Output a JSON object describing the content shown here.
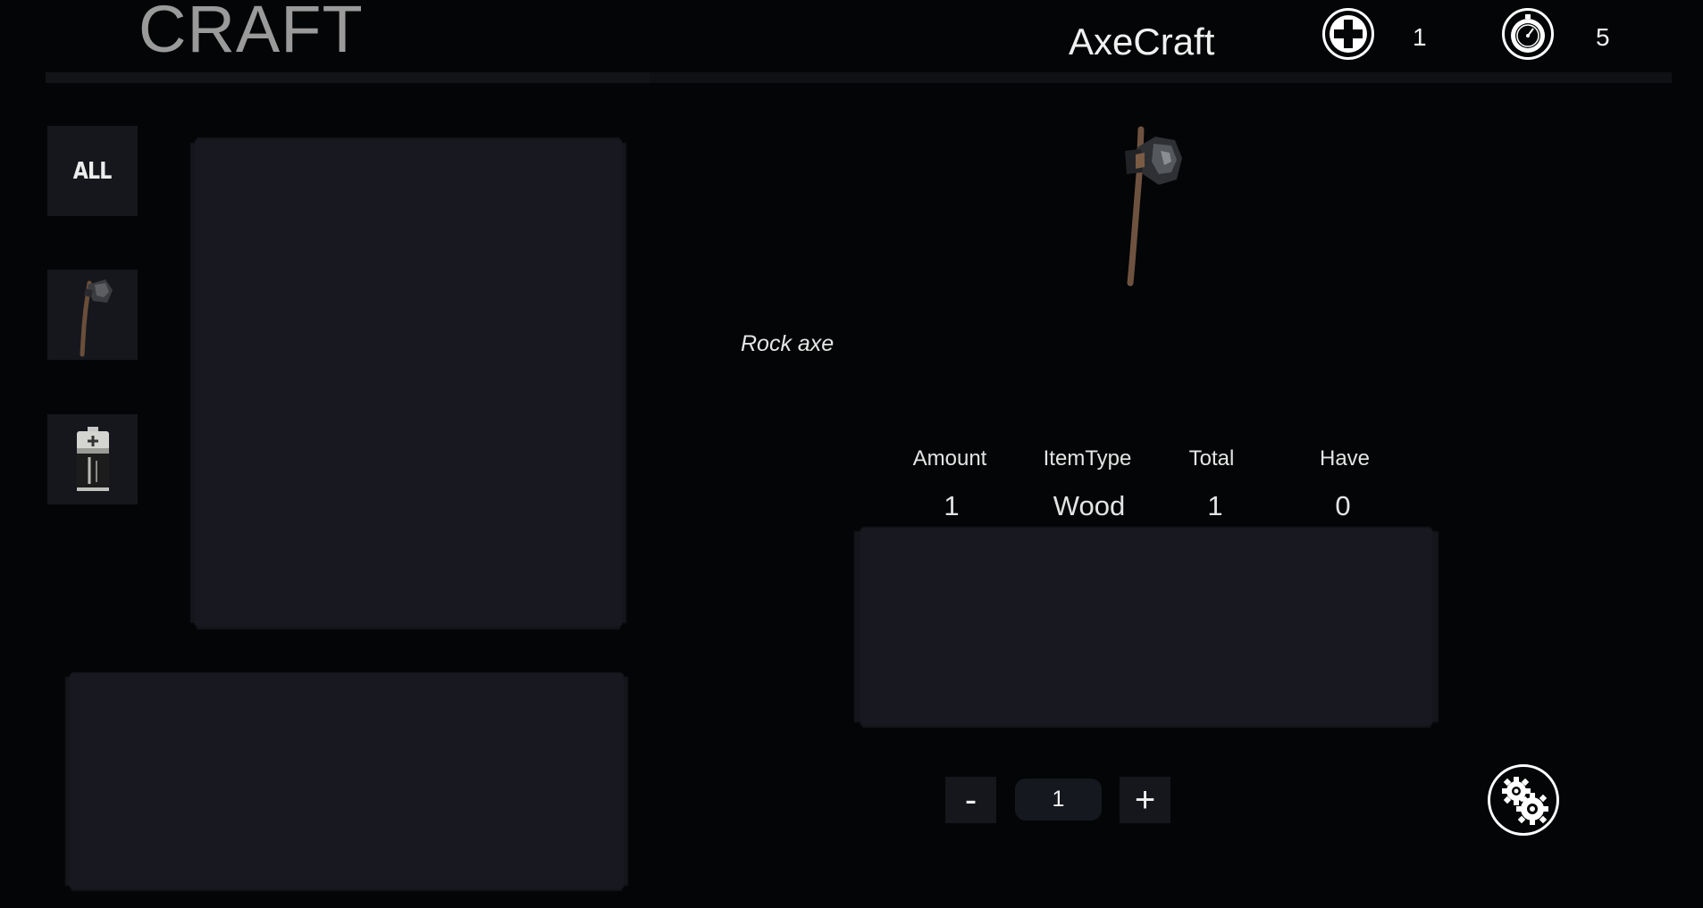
{
  "header": {
    "title": "CRAFT",
    "recipe_name": "AxeCraft",
    "health_icon": "plus-circle-icon",
    "health_value": "1",
    "timer_icon": "stopwatch-icon",
    "timer_value": "5"
  },
  "categories": [
    {
      "label": "ALL",
      "icon": "text"
    },
    {
      "label": "",
      "icon": "rock-axe-icon"
    },
    {
      "label": "",
      "icon": "battery-icon"
    }
  ],
  "detail": {
    "item_icon": "rock-axe-icon",
    "item_name": "Rock axe"
  },
  "ingredients": {
    "columns": [
      "Amount",
      "ItemType",
      "Total",
      "Have"
    ],
    "rows": [
      {
        "amount": "1",
        "item_type": "Wood",
        "total": "1",
        "have": "0"
      }
    ]
  },
  "quantity": {
    "minus_label": "-",
    "value": "1",
    "plus_label": "+"
  },
  "craft_button": {
    "icon": "gears-icon"
  },
  "colors": {
    "background": "#030506",
    "panel": "#181920",
    "button": "#15171d",
    "title": "#9a9a9a",
    "text": "#e8e8e8"
  }
}
